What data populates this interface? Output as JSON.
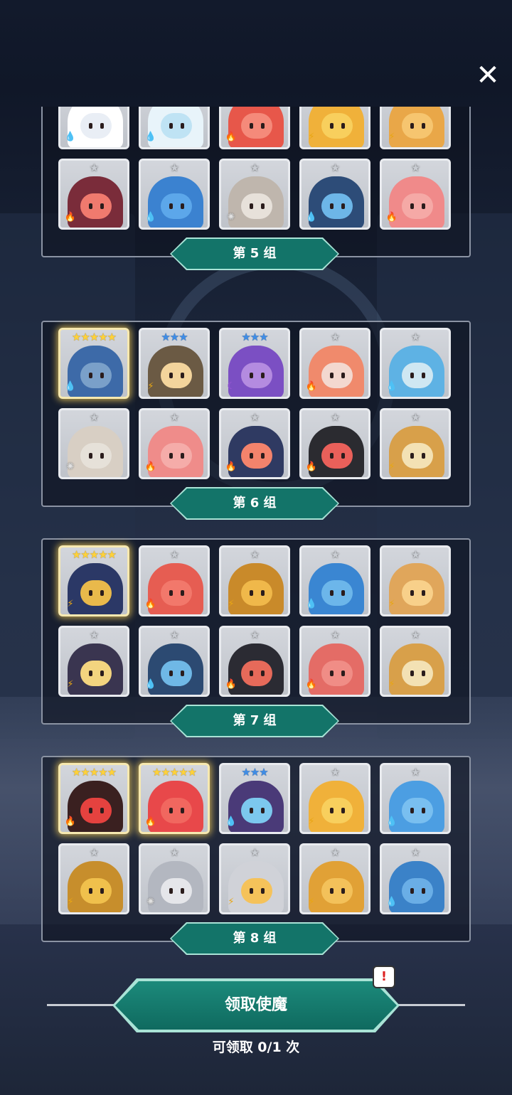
{
  "groups": [
    {
      "label": "第 5 组",
      "heroes": [
        {
          "stars": "★★★",
          "tier": "blue",
          "element": "water",
          "color": "#e9eef5",
          "hair": "#ffffff"
        },
        {
          "stars": "★★★",
          "tier": "blue",
          "element": "water",
          "color": "#bfe3f4",
          "hair": "#e8f4fa"
        },
        {
          "stars": "★",
          "tier": "gray",
          "element": "fire",
          "color": "#f58a7a",
          "hair": "#e7574a"
        },
        {
          "stars": "★",
          "tier": "gray",
          "element": "thunder",
          "color": "#f8cf5d",
          "hair": "#f0b13a"
        },
        {
          "stars": "★",
          "tier": "gray",
          "element": "thunder",
          "color": "#f6c56f",
          "hair": "#e9a748"
        },
        {
          "stars": "★",
          "tier": "gray",
          "element": "fire",
          "color": "#f07a6e",
          "hair": "#7a2c3a"
        },
        {
          "stars": "★",
          "tier": "gray",
          "element": "water",
          "color": "#5ca7ea",
          "hair": "#3b82d0"
        },
        {
          "stars": "★",
          "tier": "gray",
          "element": "light",
          "color": "#e7e1da",
          "hair": "#bfb6ad"
        },
        {
          "stars": "★",
          "tier": "gray",
          "element": "water",
          "color": "#6db6e8",
          "hair": "#2d4c78"
        },
        {
          "stars": "★",
          "tier": "gray",
          "element": "fire",
          "color": "#f5a9a6",
          "hair": "#f08a8a"
        }
      ]
    },
    {
      "label": "第 6 组",
      "heroes": [
        {
          "stars": "★★★★★",
          "tier": "gold",
          "element": "water",
          "color": "#7aa0c9",
          "hair": "#3d6aa8",
          "legend": true
        },
        {
          "stars": "★★★",
          "tier": "blue",
          "element": "thunder",
          "color": "#f3d49c",
          "hair": "#6b5a44"
        },
        {
          "stars": "★★★",
          "tier": "blue",
          "element": "dark",
          "color": "#b48be0",
          "hair": "#7b4fc3"
        },
        {
          "stars": "★",
          "tier": "gray",
          "element": "fire",
          "color": "#f3d8cf",
          "hair": "#f08a6c"
        },
        {
          "stars": "★",
          "tier": "gray",
          "element": "water",
          "color": "#cfe7f2",
          "hair": "#5eb2e4"
        },
        {
          "stars": "★",
          "tier": "gray",
          "element": "light",
          "color": "#e6e1d9",
          "hair": "#d8cfc4"
        },
        {
          "stars": "★",
          "tier": "gray",
          "element": "fire",
          "color": "#f5aca9",
          "hair": "#ef8c8a"
        },
        {
          "stars": "★",
          "tier": "gray",
          "element": "fire",
          "color": "#f3836c",
          "hair": "#2f3a62"
        },
        {
          "stars": "★",
          "tier": "gray",
          "element": "fire",
          "color": "#e9605a",
          "hair": "#2b2b30"
        },
        {
          "stars": "★",
          "tier": "gray",
          "element": "thunder",
          "color": "#f3e1b4",
          "hair": "#d8a04a"
        }
      ]
    },
    {
      "label": "第 7 组",
      "heroes": [
        {
          "stars": "★★★★★",
          "tier": "gold",
          "element": "thunder",
          "color": "#e9b94b",
          "hair": "#2b3866",
          "legend": true
        },
        {
          "stars": "★",
          "tier": "gray",
          "element": "fire",
          "color": "#f2786b",
          "hair": "#e65d52"
        },
        {
          "stars": "★",
          "tier": "gray",
          "element": "thunder",
          "color": "#f0b84a",
          "hair": "#c98a2a"
        },
        {
          "stars": "★",
          "tier": "gray",
          "element": "water",
          "color": "#6cb6ea",
          "hair": "#3a86d2"
        },
        {
          "stars": "★",
          "tier": "gray",
          "element": "thunder",
          "color": "#f8d08a",
          "hair": "#e0a65b"
        },
        {
          "stars": "★",
          "tier": "gray",
          "element": "thunder",
          "color": "#f3d47f",
          "hair": "#3a3550"
        },
        {
          "stars": "★",
          "tier": "gray",
          "element": "water",
          "color": "#6fb8e6",
          "hair": "#2c4a72"
        },
        {
          "stars": "★",
          "tier": "gray",
          "element": "fire",
          "color": "#e66a5a",
          "hair": "#2b2b33"
        },
        {
          "stars": "★",
          "tier": "gray",
          "element": "fire",
          "color": "#f08d86",
          "hair": "#e46c66"
        },
        {
          "stars": "★",
          "tier": "gray",
          "element": "thunder",
          "color": "#f3e1b4",
          "hair": "#d8a04a"
        }
      ]
    },
    {
      "label": "第 8 组",
      "heroes": [
        {
          "stars": "★★★★★",
          "tier": "gold",
          "element": "fire",
          "color": "#e5423f",
          "hair": "#3a2020",
          "legend": true
        },
        {
          "stars": "★★★★★",
          "tier": "gold",
          "element": "fire",
          "color": "#f1675f",
          "hair": "#e8484a",
          "legend": true
        },
        {
          "stars": "★★★",
          "tier": "blue",
          "element": "water",
          "color": "#7cc8ee",
          "hair": "#4a3a78"
        },
        {
          "stars": "★",
          "tier": "gray",
          "element": "thunder",
          "color": "#f8cf5d",
          "hair": "#f0b13a"
        },
        {
          "stars": "★",
          "tier": "gray",
          "element": "water",
          "color": "#79bff0",
          "hair": "#4c9ee2"
        },
        {
          "stars": "★",
          "tier": "gray",
          "element": "thunder",
          "color": "#f0c04c",
          "hair": "#c78e2c"
        },
        {
          "stars": "★",
          "tier": "gray",
          "element": "light",
          "color": "#e5e6ea",
          "hair": "#b3b7c0"
        },
        {
          "stars": "★",
          "tier": "gray",
          "element": "thunder",
          "color": "#f5c25a",
          "hair": "#d0d2d8"
        },
        {
          "stars": "★",
          "tier": "gray",
          "element": "thunder",
          "color": "#f3c15a",
          "hair": "#e1a136"
        },
        {
          "stars": "★",
          "tier": "gray",
          "element": "water",
          "color": "#6aaee6",
          "hair": "#3b82c8"
        }
      ]
    }
  ],
  "claim": {
    "button_label": "领取使魔",
    "info": "可领取 0/1 次",
    "alert": "!"
  },
  "close_icon": "✕",
  "element_icons": {
    "water": "💧",
    "fire": "🔥",
    "thunder": "⚡",
    "light": "✺",
    "dark": "☾"
  },
  "colors": {
    "accent": "#137469",
    "accent_light": "#a9e3d6",
    "legend_glow": "#ffd23a",
    "rare_star": "#3f8de6"
  }
}
